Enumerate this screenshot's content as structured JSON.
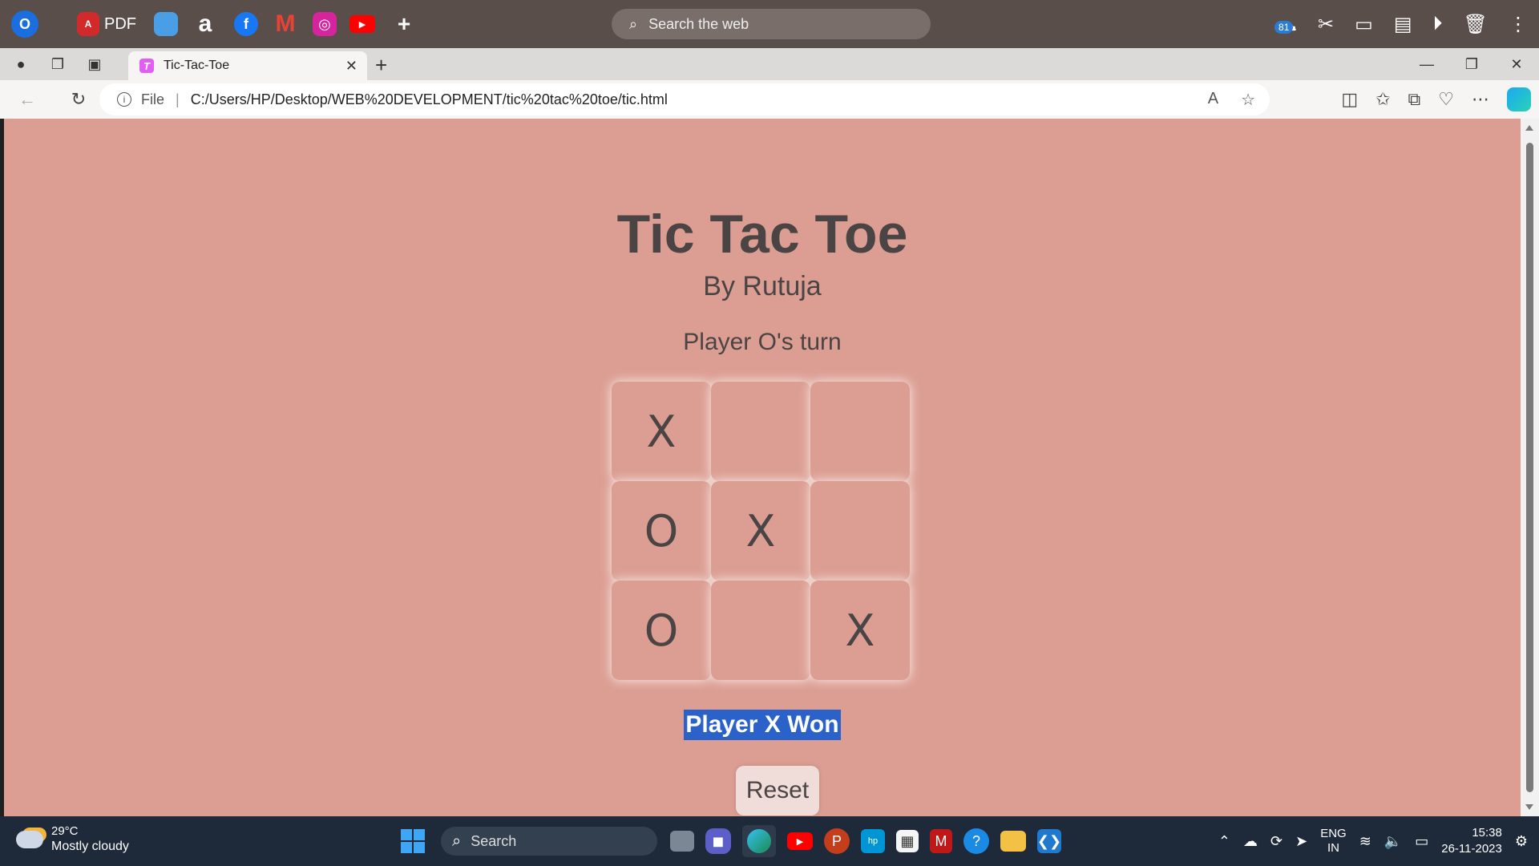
{
  "appbar": {
    "pdf_label": "PDF",
    "search_placeholder": "Search the web",
    "notification_count": "81"
  },
  "browser": {
    "tab_title": "Tic-Tac-Toe",
    "tab_favicon": "T",
    "url_scheme_label": "File",
    "url": "C:/Users/HP/Desktop/WEB%20DEVELOPMENT/tic%20tac%20toe/tic.html"
  },
  "page": {
    "background": "#dc9e93",
    "title": "Tic Tac Toe",
    "subtitle": "By Rutuja",
    "turn_text": "Player O's turn",
    "board": [
      "X",
      "",
      "",
      "O",
      "X",
      "",
      "O",
      "",
      "X"
    ],
    "winner_text": "Player X Won",
    "reset_label": "Reset"
  },
  "taskbar": {
    "temperature": "29°C",
    "weather_desc": "Mostly cloudy",
    "search_placeholder": "Search",
    "lang_line1": "ENG",
    "lang_line2": "IN",
    "time": "15:38",
    "date": "26-11-2023"
  }
}
